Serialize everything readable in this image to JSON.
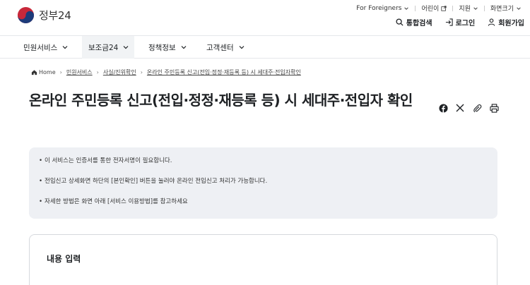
{
  "header": {
    "logo_text": "정부24",
    "util": {
      "foreigners": "For Foreigners",
      "kids": "어린이",
      "region": "지원",
      "zoom": "화면크기"
    },
    "actions": {
      "search": "통합검색",
      "login": "로그인",
      "signup": "회원가입"
    }
  },
  "nav": {
    "items": [
      {
        "label": "민원서비스"
      },
      {
        "label": "보조금24"
      },
      {
        "label": "정책정보"
      },
      {
        "label": "고객센터"
      }
    ]
  },
  "breadcrumb": [
    "Home",
    "민원서비스",
    "사실/진위확인",
    "온라인 주민등록 신고(전입·정정·재등록 등) 시 세대주·전입자확인"
  ],
  "page": {
    "title": "온라인 주민등록 신고(전입·정정·재등록 등) 시 세대주·전입자 확인",
    "notices": [
      "이 서비스는 인증서를 통한 전자서명이 필요합니다.",
      "전입신고 상세화면 하단의 [본인확인] 버튼을 눌러야 온라인 전입신고 처리가 가능합니다.",
      "자세한 방법은 화면 아래 [서비스 이용방법]를 참고하세요"
    ],
    "form_title": "내용 입력"
  },
  "icons": [
    "facebook-icon",
    "x-icon",
    "link-icon",
    "print-icon"
  ]
}
